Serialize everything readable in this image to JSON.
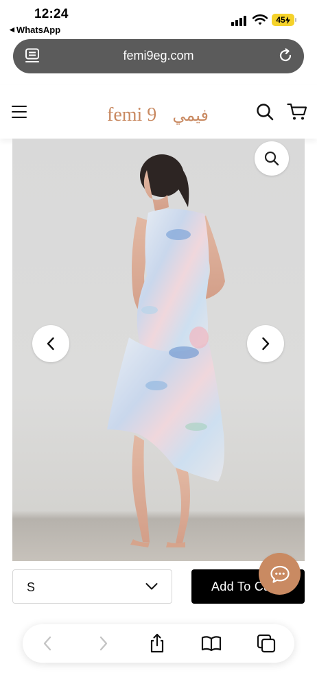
{
  "status_bar": {
    "time": "12:24",
    "back_app": "WhatsApp",
    "back_arrow": "◀",
    "battery": "45"
  },
  "browser": {
    "url": "femi9eg.com"
  },
  "site_header": {
    "logo_latin": "femi 9",
    "logo_arabic": "فيمي"
  },
  "purchase": {
    "size_value": "S",
    "add_to_cart_label": "Add To Cart"
  },
  "colors": {
    "brand": "#c98a62",
    "address_bar": "#5b5b5b",
    "battery": "#f5d22a",
    "button_black": "#000000"
  },
  "icons": [
    "page-icon",
    "reload-icon",
    "menu-icon",
    "search-icon",
    "cart-icon",
    "zoom-icon",
    "chevron-left-icon",
    "chevron-right-icon",
    "chevron-down-icon",
    "chat-icon",
    "back-icon",
    "forward-icon",
    "share-icon",
    "bookmarks-icon",
    "tabs-icon"
  ]
}
